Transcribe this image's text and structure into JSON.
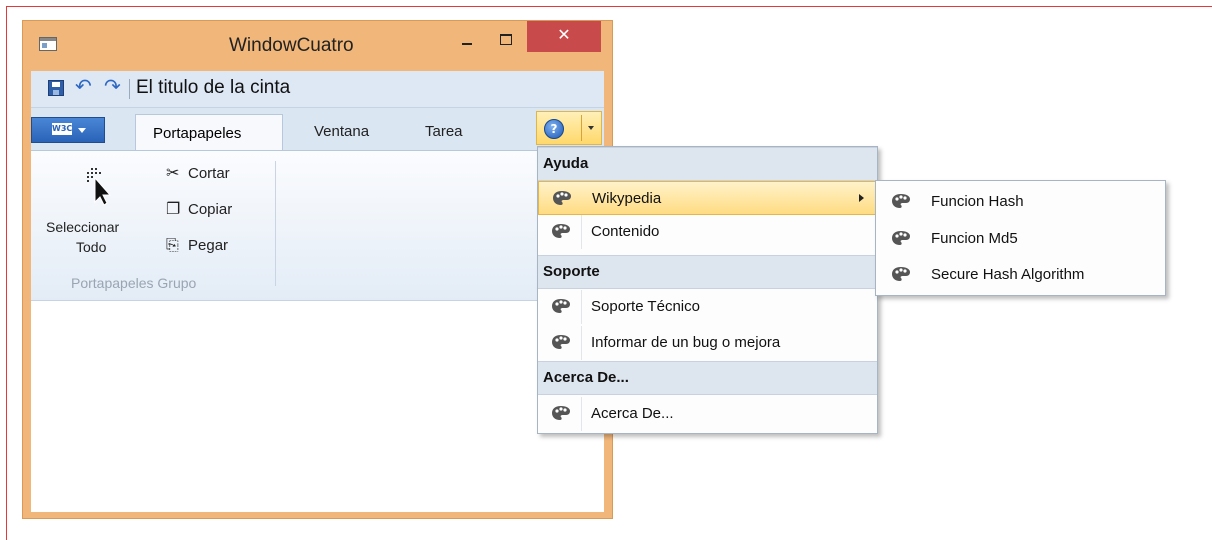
{
  "window": {
    "title": "WindowCuatro",
    "close_glyph": "✕",
    "icons": {
      "app": "window-app-icon",
      "minimize": "minimize-icon",
      "maximize": "maximize-icon",
      "close": "close-icon"
    }
  },
  "quick_access": {
    "title": "El titulo de la cinta",
    "icons": [
      "save-icon",
      "undo-icon",
      "redo-icon"
    ],
    "undo_glyph": "↶",
    "redo_glyph": "↷"
  },
  "ribbon": {
    "app_menu_logo": "W3C",
    "tabs": [
      {
        "label": "Portapapeles",
        "active": true
      },
      {
        "label": "Ventana",
        "active": false
      },
      {
        "label": "Tarea",
        "active": false
      }
    ],
    "help_button": {
      "icon": "help-icon",
      "glyph": "?"
    },
    "group": {
      "label": "Portapapeles Grupo",
      "select_all": {
        "line1": "Seleccionar",
        "line2": "Todo",
        "icon": "select-all-cursor-icon"
      },
      "buttons": [
        {
          "label": "Cortar",
          "icon": "cut-icon",
          "glyph": "✂"
        },
        {
          "label": "Copiar",
          "icon": "copy-icon",
          "glyph": "❐"
        },
        {
          "label": "Pegar",
          "icon": "paste-icon",
          "glyph": "⎘"
        }
      ]
    }
  },
  "help_menu": {
    "sections": [
      {
        "header": "Ayuda",
        "items": [
          {
            "label": "Wikypedia",
            "has_submenu": true,
            "highlighted": true
          },
          {
            "label": "Contenido"
          }
        ]
      },
      {
        "header": "Soporte",
        "items": [
          {
            "label": "Soporte Técnico"
          },
          {
            "label": "Informar de un bug o mejora"
          }
        ]
      },
      {
        "header": "Acerca De...",
        "items": [
          {
            "label": "Acerca De..."
          }
        ]
      }
    ],
    "item_icon": "palette-icon",
    "highlight_color": "#ffdc82"
  },
  "submenu": {
    "items": [
      {
        "label": "Funcion Hash"
      },
      {
        "label": "Funcion Md5"
      },
      {
        "label": "Secure Hash Algorithm"
      }
    ]
  },
  "colors": {
    "window_frame": "#f0b67a",
    "close_button": "#c94a4b",
    "ribbon_bg": "#dbe6f3",
    "outer_border": "#e03a3a"
  }
}
